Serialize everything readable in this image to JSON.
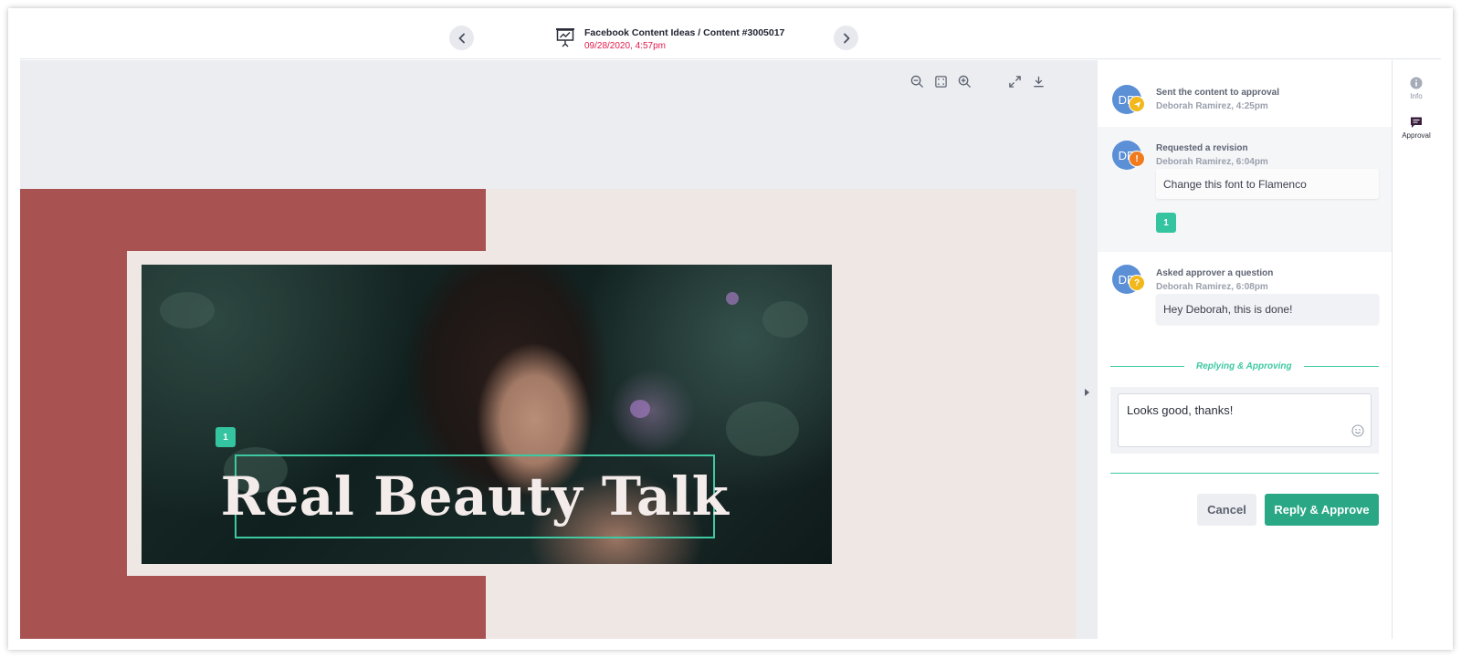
{
  "header": {
    "title": "Facebook Content Ideas / Content #3005017",
    "timestamp": "09/28/2020, 4:57pm",
    "prev_icon": "chevron-left-icon",
    "next_icon": "chevron-right-icon",
    "doc_icon": "presentation-icon"
  },
  "toolbar": {
    "zoom_out_icon": "zoom-out-icon",
    "fit_icon": "fit-screen-icon",
    "zoom_in_icon": "zoom-in-icon",
    "expand_icon": "expand-icon",
    "download_icon": "download-icon"
  },
  "artwork": {
    "headline": "Real Beauty Talk",
    "pin_number": "1"
  },
  "activities": [
    {
      "avatar": "DR",
      "badge": "send-icon",
      "title": "Sent the content to approval",
      "meta": "Deborah Ramirez, 4:25pm"
    },
    {
      "avatar": "DR",
      "badge": "!",
      "title": "Requested a revision",
      "meta": "Deborah Ramirez, 6:04pm",
      "comment": "Change this font to Flamenco",
      "pin": "1"
    },
    {
      "avatar": "DR",
      "badge": "?",
      "title": "Asked approver a question",
      "meta": "Deborah Ramirez, 6:08pm",
      "comment": "Hey Deborah, this is done!"
    }
  ],
  "reply": {
    "section_label": "Replying & Approving",
    "value": "Looks good, thanks!",
    "emoji_icon": "smiley-icon",
    "cancel_label": "Cancel",
    "approve_label": "Reply & Approve"
  },
  "rail": {
    "info_label": "Info",
    "approval_label": "Approval"
  },
  "colors": {
    "accent": "#2aa886",
    "alert": "#e2194b",
    "avatar": "#5b8fd6",
    "badge_send": "#f2b81b",
    "badge_revision": "#f07a1e",
    "badge_question": "#f2b81b",
    "artwork_red": "#a85351"
  }
}
